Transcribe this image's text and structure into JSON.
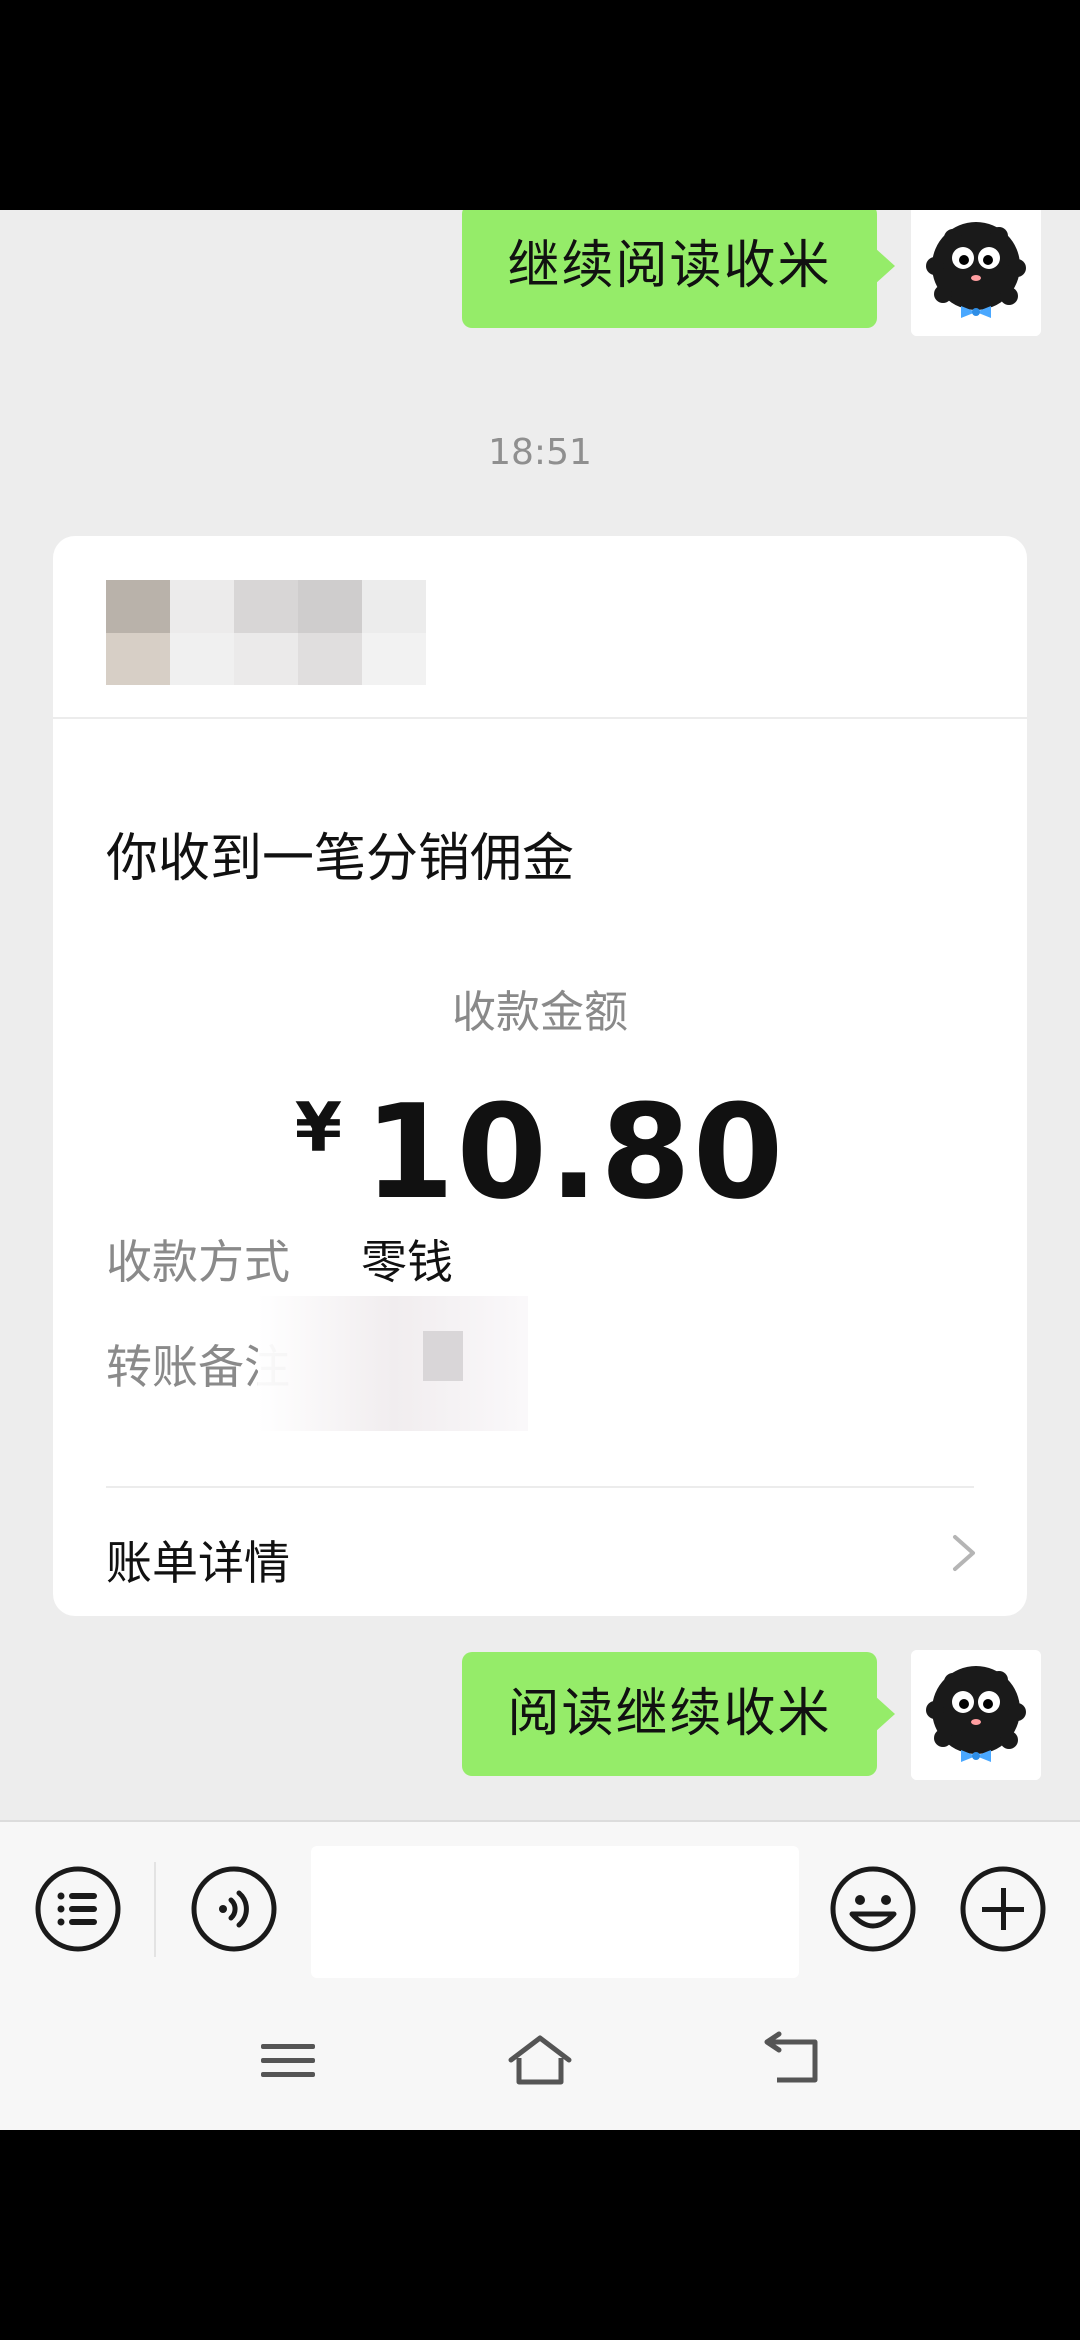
{
  "chat": {
    "messages": [
      {
        "text": "继续阅读收米"
      },
      {
        "text": "阅读继续收米"
      }
    ],
    "timestamp": "18:51"
  },
  "payment_card": {
    "title": "你收到一笔分销佣金",
    "amount_label": "收款金额",
    "currency": "¥",
    "amount": "10.80",
    "method_label": "收款方式",
    "method_value": "零钱",
    "note_label": "转账备注",
    "details_label": "账单详情"
  },
  "input_bar": {
    "message_value": ""
  },
  "colors": {
    "bubble": "#95ec69",
    "background": "#ededed",
    "card": "#ffffff"
  },
  "icons": {
    "menu": "list-menu-icon",
    "voice": "voice-icon",
    "emoji": "emoji-icon",
    "add": "add-icon",
    "nav_menu": "nav-menu-icon",
    "nav_home": "home-icon",
    "nav_back": "back-icon"
  }
}
